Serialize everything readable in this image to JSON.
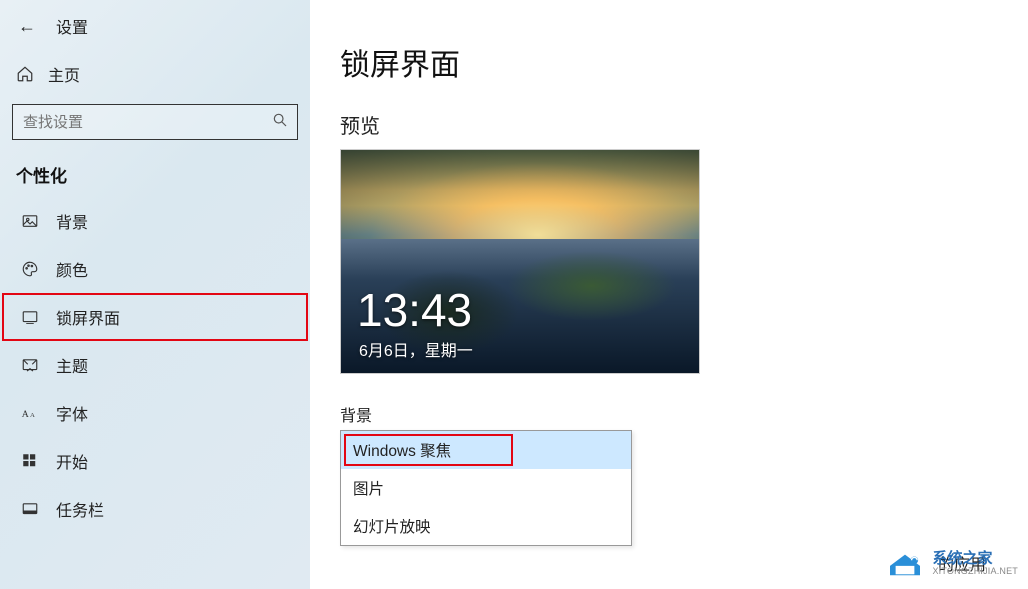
{
  "header": {
    "title": "设置"
  },
  "home": {
    "label": "主页"
  },
  "search": {
    "placeholder": "查找设置"
  },
  "section": {
    "title": "个性化"
  },
  "nav": [
    {
      "label": "背景",
      "icon": "picture"
    },
    {
      "label": "颜色",
      "icon": "palette"
    },
    {
      "label": "锁屏界面",
      "icon": "lockscreen",
      "highlight": true
    },
    {
      "label": "主题",
      "icon": "theme"
    },
    {
      "label": "字体",
      "icon": "font"
    },
    {
      "label": "开始",
      "icon": "start"
    },
    {
      "label": "任务栏",
      "icon": "taskbar"
    }
  ],
  "main": {
    "title": "锁屏界面",
    "preview_label": "预览",
    "preview": {
      "time": "13:43",
      "date": "6月6日，星期一"
    },
    "background_label": "背景",
    "dropdown": [
      {
        "label": "Windows 聚焦",
        "selected": true
      },
      {
        "label": "图片"
      },
      {
        "label": "幻灯片放映"
      }
    ],
    "truncated_text": "的应用"
  },
  "watermark": {
    "cn": "系统之家",
    "en": "XITONGZHIJIA.NET"
  }
}
